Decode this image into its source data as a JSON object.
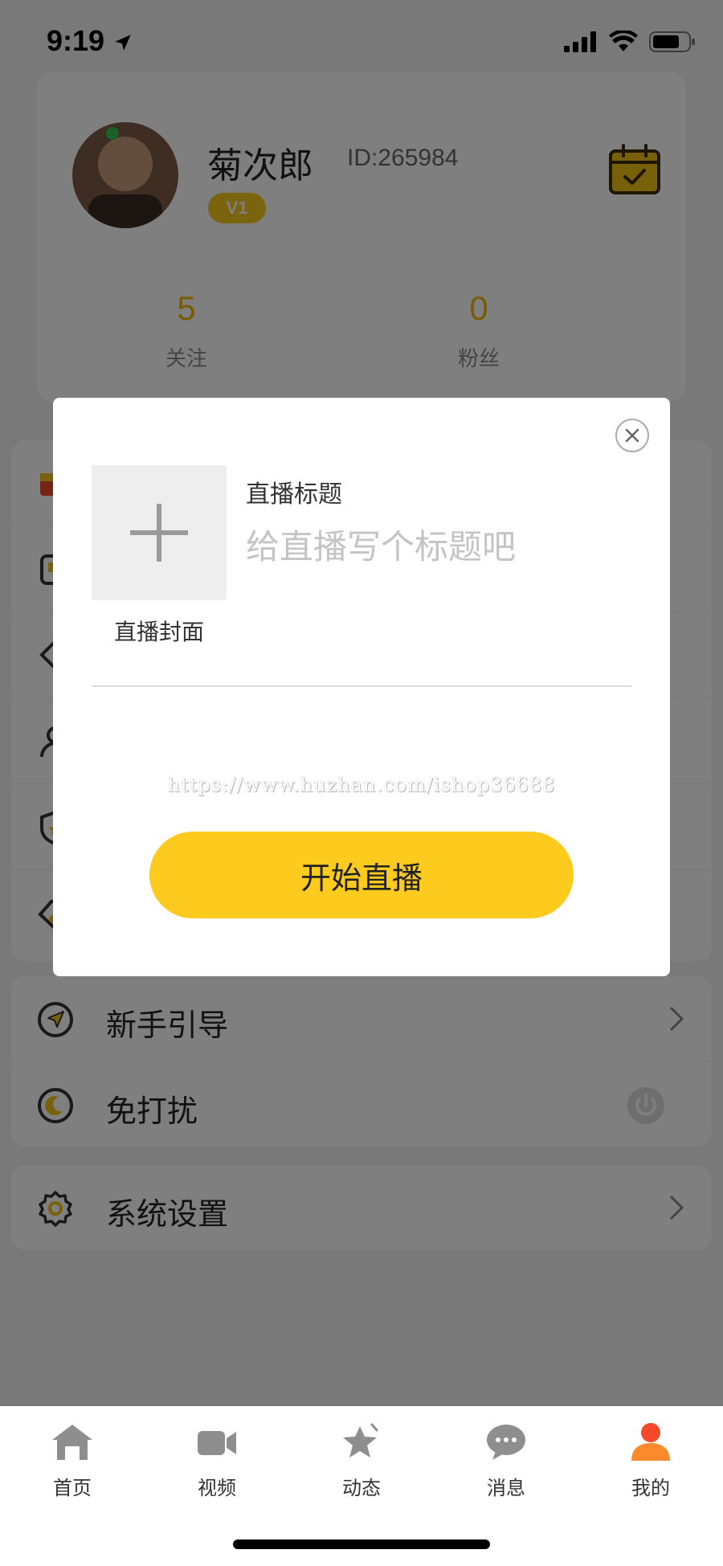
{
  "status_bar": {
    "time": "9:19"
  },
  "profile": {
    "username": "菊次郎",
    "user_id": "ID:265984",
    "vip_level": "V1",
    "stats": [
      {
        "value": "5",
        "label": "关注"
      },
      {
        "value": "0",
        "label": "粉丝"
      }
    ]
  },
  "menu": {
    "group3": [
      {
        "icon": "navigation-arrow-icon",
        "label": "新手引导",
        "action": "chevron-right-icon"
      },
      {
        "icon": "moon-icon",
        "label": "免打扰",
        "action": "power-toggle-icon"
      }
    ],
    "group4": [
      {
        "icon": "gear-icon",
        "label": "系统设置",
        "action": "chevron-right-icon"
      }
    ]
  },
  "tab_bar": {
    "tabs": [
      {
        "label": "首页",
        "icon": "home-icon",
        "active": false
      },
      {
        "label": "视频",
        "icon": "video-camera-icon",
        "active": false
      },
      {
        "label": "动态",
        "icon": "star-icon",
        "active": false
      },
      {
        "label": "消息",
        "icon": "chat-bubble-icon",
        "active": false
      },
      {
        "label": "我的",
        "icon": "user-icon",
        "active": true
      }
    ],
    "active_color": "#f6492b"
  },
  "modal": {
    "cover_label": "直播封面",
    "title_label": "直播标题",
    "title_placeholder": "给直播写个标题吧",
    "title_value": "",
    "watermark": "https://www.huzhan.com/ishop36688",
    "start_button": "开始直播",
    "accent_color": "#fdcb1d"
  }
}
